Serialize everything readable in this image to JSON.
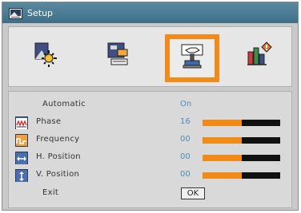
{
  "window": {
    "title": "Setup",
    "title_icon": "setup-menu-icon"
  },
  "tabs": [
    {
      "name": "picture-tab",
      "icon": "picture-brightness-icon",
      "selected": false
    },
    {
      "name": "display-tab",
      "icon": "display-screen-icon",
      "selected": false
    },
    {
      "name": "setup-tab",
      "icon": "hand-setup-icon",
      "selected": true
    },
    {
      "name": "options-tab",
      "icon": "options-bars-icon",
      "selected": false
    }
  ],
  "rows": [
    {
      "label": "Automatic",
      "value": "On",
      "icon": null,
      "slider": null
    },
    {
      "label": "Phase",
      "value": "16",
      "icon": "phase-waveform-icon",
      "slider": 0.5
    },
    {
      "label": "Frequency",
      "value": "00",
      "icon": "frequency-signal-icon",
      "slider": 0.5
    },
    {
      "label": "H. Position",
      "value": "00",
      "icon": "horizontal-arrows-icon",
      "slider": 0.5
    },
    {
      "label": "V. Position",
      "value": "00",
      "icon": "vertical-arrows-icon",
      "slider": 0.5
    },
    {
      "label": "Exit",
      "button": "OK"
    }
  ],
  "colors": {
    "accent": "#f28a17",
    "title_bar": "#4a7c94",
    "value_text": "#4a8fb9",
    "panel_bg": "#d9d9d9"
  }
}
